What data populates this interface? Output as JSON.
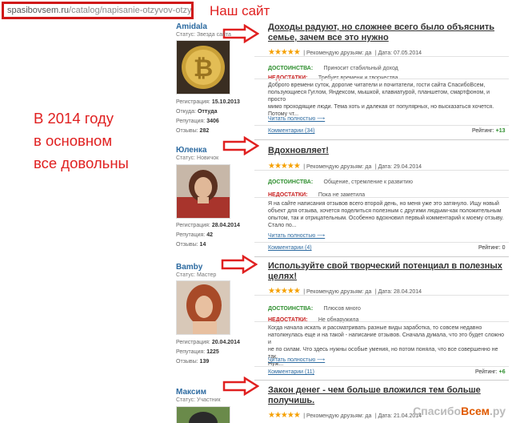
{
  "url": {
    "domain": "spasibovsem.ru",
    "path": "/catalog/napisanie-otzyvov-otzyvy/"
  },
  "notes": {
    "site": "Наш сайт",
    "line1": "В 2014 году",
    "line2": "в основном",
    "line3": "все довольны"
  },
  "reviews": [
    {
      "user": {
        "name": "Amidala",
        "status": "Статус: Звезда сайта",
        "reg_label": "Регистрация:",
        "reg": "15.10.2013",
        "from_label": "Откуда:",
        "from": "Оттуда",
        "rep_label": "Репутация:",
        "rep": "3406",
        "reviews_label": "Отзывы:",
        "reviews": "282"
      },
      "title_line1": "Доходы радуют, но сложнее всего было объяснить",
      "title_line2": "семье, зачем все это нужно",
      "stars": "★★★★★",
      "recommend": "Рекомендую друзьям: да",
      "date": "Дата: 07.05.2014",
      "pros_label": "ДОСТОИНСТВА:",
      "pros": "Приносит стабильный доход",
      "cons_label": "НЕДОСТАТКИ:",
      "cons": "Требует времени и творчества",
      "body1": "Доброго времени суток, дорогие читатели и почитатели, гости сайта СпасибоВсем,",
      "body2": "пользующиеся Гуглом, Яндексом, мышкой, клавиатурой, планшетом, смартфоном, и просто",
      "body3": "мимо проходящие люди. Тема хоть и далекая от популярных, но высказаться хочется.",
      "body4": "Потому чт...",
      "more": "Читать полностью ⟶",
      "comments": "Комментарии (34)",
      "rating_label": "Рейтинг:",
      "rating": "+13"
    },
    {
      "user": {
        "name": "Юленка",
        "status": "Статус: Новичок",
        "reg_label": "Регистрация:",
        "reg": "28.04.2014",
        "rep_label": "Репутация:",
        "rep": "42",
        "reviews_label": "Отзывы:",
        "reviews": "14"
      },
      "title_line1": "Вдохновляет!",
      "stars": "★★★★★",
      "recommend": "Рекомендую друзьям: да",
      "date": "Дата: 29.04.2014",
      "pros_label": "ДОСТОИНСТВА:",
      "pros": "Общение, стремление к развитию",
      "cons_label": "НЕДОСТАТКИ:",
      "cons": "Пока не заметила",
      "body1": "Я на сайте написания отзывов всего второй день, но меня уже это затянуло. Ищу новый",
      "body2": "объект для отзыва, хочется поделиться полезным с другими людьми-как положительным",
      "body3": "опытом, так и отрицательным. Особенно вдохновил первый комментарий к моему отзыву.",
      "body4": "Стало по...",
      "more": "Читать полностью ⟶",
      "comments": "Комментарии (4)",
      "rating_label": "Рейтинг:",
      "rating": "0"
    },
    {
      "user": {
        "name": "Bamby",
        "status": "Статус: Мастер",
        "reg_label": "Регистрация:",
        "reg": "20.04.2014",
        "rep_label": "Репутация:",
        "rep": "1225",
        "reviews_label": "Отзывы:",
        "reviews": "139"
      },
      "title_line1": "Используйте свой творческий потенциал в полезных",
      "title_line2": "целях!",
      "stars": "★★★★★",
      "recommend": "Рекомендую друзьям: да",
      "date": "Дата: 28.04.2014",
      "pros_label": "ДОСТОИНСТВА:",
      "pros": "Плюсов много",
      "cons_label": "НЕДОСТАТКИ:",
      "cons": "Не обнаружила",
      "body1": "Когда начала искать и рассматривать разные виды заработка, то совсем недавно",
      "body2": "натолкнулась еще и на такой - написание отзывов. Сначала думала, что это будет сложно и",
      "body3": "не по силам. Что здесь нужны особые умения, но потом поняла, что все совершенно не так.",
      "body4": "Нуж...",
      "more": "Читать полностью ⟶",
      "comments": "Комментарии (11)",
      "rating_label": "Рейтинг:",
      "rating": "+6"
    },
    {
      "user": {
        "name": "Максим",
        "status": "Статус: Участник"
      },
      "title_line1": "Закон денег - чем больше вложился тем больше",
      "title_line2": "получишь.",
      "stars": "★★★★★",
      "recommend": "Рекомендую друзьям: да",
      "date": "Дата: 21.04.2014"
    }
  ],
  "watermark": {
    "pre": "Спасибо",
    "accent": "Всем",
    "post": ".ру"
  },
  "colors": {
    "accent_red": "#e02020",
    "link_blue": "#2c6aa0",
    "star": "#f5a000",
    "pros_green": "#2f8f2f"
  }
}
